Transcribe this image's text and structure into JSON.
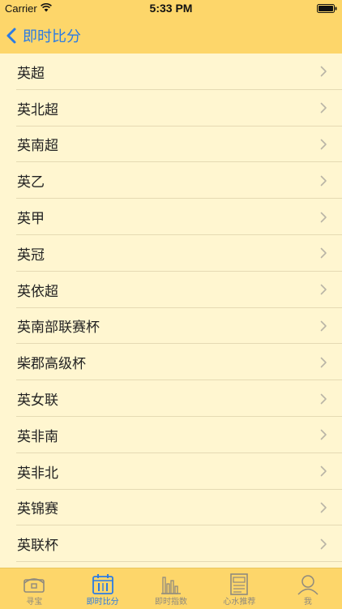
{
  "status_bar": {
    "carrier": "Carrier",
    "time": "5:33 PM"
  },
  "nav": {
    "back_label": "即时比分"
  },
  "list": {
    "items": [
      {
        "label": "英超"
      },
      {
        "label": "英北超"
      },
      {
        "label": "英南超"
      },
      {
        "label": "英乙"
      },
      {
        "label": "英甲"
      },
      {
        "label": "英冠"
      },
      {
        "label": "英依超"
      },
      {
        "label": "英南部联赛杯"
      },
      {
        "label": "柴郡高级杯"
      },
      {
        "label": "英女联"
      },
      {
        "label": "英非南"
      },
      {
        "label": "英非北"
      },
      {
        "label": "英锦赛"
      },
      {
        "label": "英联杯"
      }
    ]
  },
  "tab_bar": {
    "active_color": "#2A7BE4",
    "inactive_color": "#8F8A7E",
    "tabs": [
      {
        "label": "寻宝",
        "icon": "treasure-chest-icon",
        "active": false
      },
      {
        "label": "即时比分",
        "icon": "calendar-scoreboard-icon",
        "active": true
      },
      {
        "label": "即时指数",
        "icon": "bar-chart-icon",
        "active": false
      },
      {
        "label": "心水推荐",
        "icon": "document-icon",
        "active": false
      },
      {
        "label": "我",
        "icon": "user-profile-icon",
        "active": false
      }
    ]
  },
  "colors": {
    "header_bg": "#FDD66A",
    "list_bg": "#FFF6D0",
    "accent": "#2A7BE4"
  }
}
